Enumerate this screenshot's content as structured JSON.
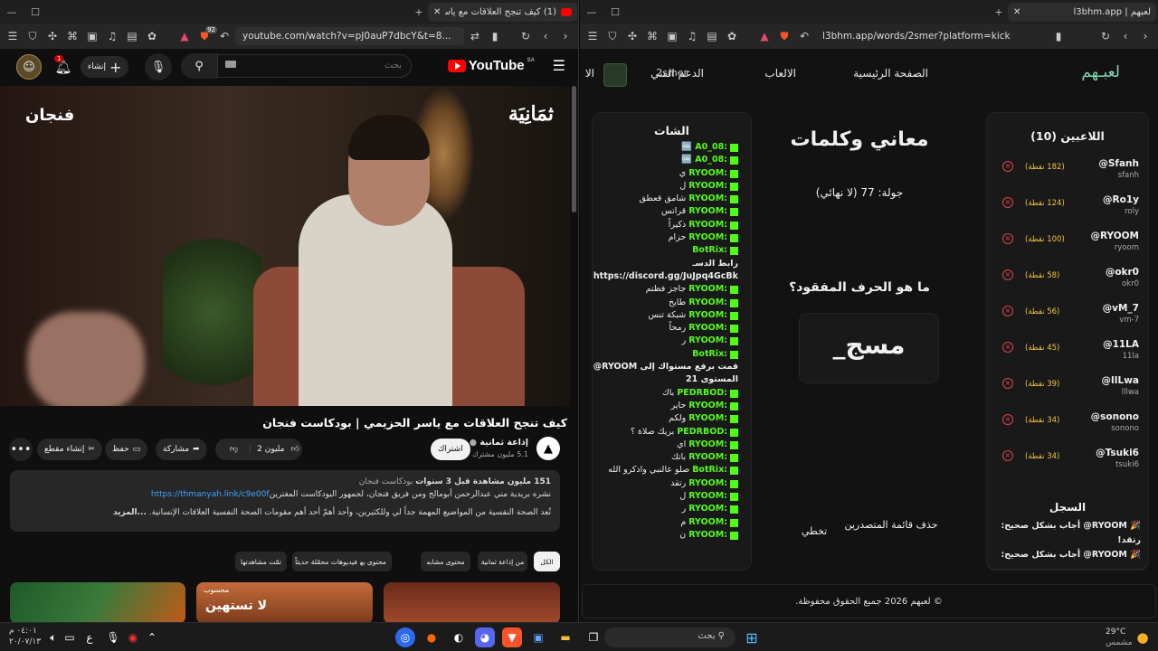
{
  "left_browser": {
    "tab_title": "(1) كيف تنجح العلاقات مع ياسر ا",
    "brave_badge": "92",
    "url": "youtube.com/watch?v=pJ0auP7dbcY&t=8..."
  },
  "youtube": {
    "logo": "YouTube",
    "region": "SA",
    "search_placeholder": "بحث",
    "create_label": "إنشاء",
    "notif_count": "1",
    "video_overlay_right": "ثمَانِيَة",
    "video_overlay_left": "فنجان",
    "title": "كيف تنجح العلاقات مع ياسر الحزيمي | بودكاست فنجان",
    "channel": "إذاعة ثمانية",
    "subscribers": "5.1 مليون مشترك",
    "subscribe": "اشتراك",
    "likes": "2 مليون",
    "share": "مشاركة",
    "save": "حفظ",
    "clip": "إنشاء مقطع",
    "description": {
      "stats": "151 مليون مشاهدة قبل 3 سنوات",
      "tag": "بودكاست فنجان",
      "line1": "نشره بريدية مني عبدالرحمن أبومالح ومن فريق فنجان، لجمهور البودكاست المغترين",
      "link": "https://thmanyah.link/c9e00f",
      "line2": "تُعد الصحة النفسية من المواضيع المهمة جداً لي وللكثيرين، وأحد أهمّ أحد أهم مقومات الصحة النفسية العلاقات الإنسانية.",
      "more": "...المزيد"
    },
    "filters": [
      "الكل",
      "من إذاعة ثمانية",
      "محتوى مشابه",
      "محتوى يهمّك",
      "فيديوهات محمّلة حديثاً",
      "تمّت مشاهدتها"
    ],
    "thumb_text": "لا تستهين",
    "thumb_label": "محسوب"
  },
  "right_browser": {
    "tab_title": "لعبهم | l3bhm.app",
    "url": "l3bhm.app/words/2smer?platform=kick"
  },
  "app": {
    "nav": {
      "logo": "لعبـهم",
      "home": "الصفحة الرئيسية",
      "games": "الالعاب",
      "support": "الدعم الفني",
      "user": "2smer",
      "cut": "الا"
    },
    "players": {
      "title": "اللاعبين (10)",
      "list": [
        {
          "name": "@Sfanh",
          "handle": "sfanh",
          "points": "(182 نقطة)"
        },
        {
          "name": "@Ro1y",
          "handle": "roly",
          "points": "(124 نقطة)"
        },
        {
          "name": "@RYOOM",
          "handle": "ryoom",
          "points": "(100 نقطة)"
        },
        {
          "name": "@okr0",
          "handle": "okr0",
          "points": "(58 نقطة)"
        },
        {
          "name": "@vM_7",
          "handle": "vm-7",
          "points": "(56 نقطة)"
        },
        {
          "name": "@11LA",
          "handle": "11la",
          "points": "(45 نقطة)"
        },
        {
          "name": "@lILwa",
          "handle": "lllwa",
          "points": "(39 نقطة)"
        },
        {
          "name": "@sonono",
          "handle": "sonono",
          "points": "(34 نقطة)"
        },
        {
          "name": "@Tsuki6",
          "handle": "tsuki6",
          "points": "(34 نقطة)"
        }
      ]
    },
    "log": {
      "title": "السجل",
      "entries": [
        "🎉 RYOOM@ أجاب بشكل صحيح: رتقد!",
        "🎉 RYOOM@ أجاب بشكل صحيح:"
      ]
    },
    "game": {
      "title": "معاني وكلمات",
      "round": "جولة: 77 (لا نهائي)",
      "question": "ما هو الحرف المفقود؟",
      "word": "مسج_",
      "remove_leaders": "حذف قائمة المتصدرين",
      "skip": "تخطي"
    },
    "chat": {
      "title": "الشات",
      "lines": [
        {
          "u": "A0_08:",
          "m": "🆒"
        },
        {
          "u": "A0_08:",
          "m": "🆒"
        },
        {
          "u": "RYOOM:",
          "m": "ي"
        },
        {
          "u": "RYOOM:",
          "m": "ل"
        },
        {
          "u": "RYOOM:",
          "m": "شامق قعطق"
        },
        {
          "u": "RYOOM:",
          "m": "قراتس"
        },
        {
          "u": "RYOOM:",
          "m": "ذكيراً"
        },
        {
          "u": "RYOOM:",
          "m": "حزام"
        },
        {
          "u": "BotRix:",
          "m": "",
          "bot": true
        },
        {
          "u": "",
          "m": "رابط الدسـ"
        },
        {
          "u": "",
          "m": "https://discord.gg/JuJpq4GcBk"
        },
        {
          "u": "RYOOM:",
          "m": "جاجز فظتم"
        },
        {
          "u": "RYOOM:",
          "m": "طايخ"
        },
        {
          "u": "RYOOM:",
          "m": "شبكة تنس"
        },
        {
          "u": "RYOOM:",
          "m": "رمحاً"
        },
        {
          "u": "RYOOM:",
          "m": "ر"
        },
        {
          "u": "BotRix:",
          "m": "",
          "bot": true
        },
        {
          "u": "",
          "m": "قمت برفع مستواك إلى RYOOM@"
        },
        {
          "u": "",
          "m": "المستوى 21"
        },
        {
          "u": "PEDRBOD:",
          "m": "باك"
        },
        {
          "u": "RYOOM:",
          "m": "حاير"
        },
        {
          "u": "RYOOM:",
          "m": "ولكم"
        },
        {
          "u": "PEDRBOD:",
          "m": "بريك صلاة ؟"
        },
        {
          "u": "RYOOM:",
          "m": "اي"
        },
        {
          "u": "RYOOM:",
          "m": "باتك"
        },
        {
          "u": "BotRix:",
          "m": "صلو عالنبي واذكرو الله",
          "bot": true
        },
        {
          "u": "RYOOM:",
          "m": "رتقد"
        },
        {
          "u": "RYOOM:",
          "m": "ل"
        },
        {
          "u": "RYOOM:",
          "m": "ر"
        },
        {
          "u": "RYOOM:",
          "m": "م"
        },
        {
          "u": "RYOOM:",
          "m": "ن"
        }
      ]
    },
    "footer": "© لعبهم 2026 جميع الحقوق محفوظة."
  },
  "taskbar": {
    "weather_temp": "29°C",
    "weather_desc": "مشمس",
    "search": "بحث",
    "time": "٠٤:٠١ م",
    "date": "٢٠/٠٧/١٣",
    "lang": "ع"
  }
}
